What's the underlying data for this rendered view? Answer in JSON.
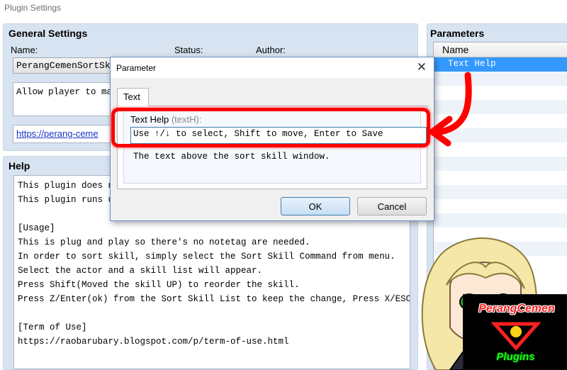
{
  "window": {
    "title": "Plugin Settings"
  },
  "general": {
    "title": "General Settings",
    "name_label": "Name:",
    "status_label": "Status:",
    "author_label": "Author:",
    "name_value": "PerangCemenSortSkill",
    "description": "Allow player to man",
    "link": "https://perang-ceme"
  },
  "help": {
    "title": "Help",
    "text": "This plugin does no\nThis plugin runs un\n\n[Usage]\nThis is plug and play so there's no notetag are needed.\nIn order to sort skill, simply select the Sort Skill Command from menu.\nSelect the actor and a skill list will appear.\nPress Shift(Moved the skill UP) to reorder the skill.\nPress Z/Enter(ok) from the Sort Skill List to keep the change, Press X/ESC(canc\n\n[Term of Use]\nhttps://raobarubary.blogspot.com/p/term-of-use.html"
  },
  "parameters": {
    "title": "Parameters",
    "column": "Name",
    "rows": [
      "Text Help"
    ]
  },
  "dialog": {
    "title": "Parameter",
    "close": "✕",
    "tab": "Text",
    "field_label": "Text Help",
    "field_key": "(textH):",
    "value": "Use ↑/↓ to select, Shift to move, Enter to Save",
    "description": "The text above the sort skill window.",
    "ok": "OK",
    "cancel": "Cancel"
  },
  "logo": {
    "title": "PerangCemen",
    "subtitle": "Plugins"
  },
  "colors": {
    "group_bg": "#d7e3f1",
    "selection": "#3399ff",
    "annotation": "#ff0000"
  },
  "icons": {
    "close": "close-icon",
    "arrow": "red-arrow-annotation"
  }
}
